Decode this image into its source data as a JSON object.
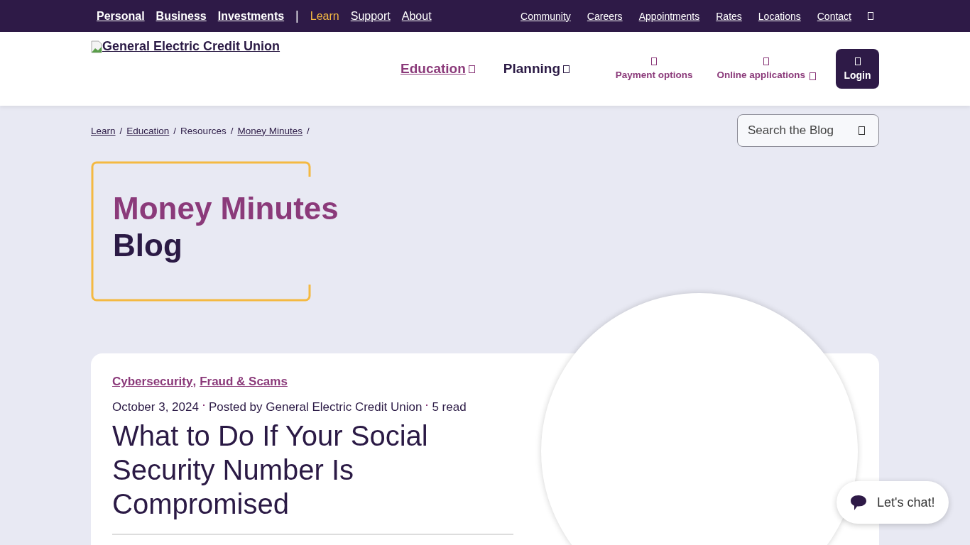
{
  "top_bar": {
    "primary_links": [
      {
        "label": "Personal",
        "selected": false
      },
      {
        "label": "Business",
        "selected": false
      },
      {
        "label": "Investments",
        "selected": false
      }
    ],
    "divider": "|",
    "secondary_links": [
      {
        "label": "Learn",
        "selected": true
      },
      {
        "label": "Support",
        "selected": false
      },
      {
        "label": "About",
        "selected": false
      }
    ],
    "utility_links": [
      "Community",
      "Careers",
      "Appointments",
      "Rates",
      "Locations",
      "Contact"
    ]
  },
  "header": {
    "logo_alt": "General Electric Credit Union",
    "nav": [
      {
        "label": "Education",
        "selected": true
      },
      {
        "label": "Planning",
        "selected": false
      }
    ],
    "actions": [
      {
        "label": "Payment options",
        "has_caret": false
      },
      {
        "label": "Online applications",
        "has_caret": true
      }
    ],
    "login": "Login"
  },
  "breadcrumb": [
    {
      "label": "Learn",
      "link": true,
      "separator": "/"
    },
    {
      "label": "Education",
      "link": true,
      "separator": "/"
    },
    {
      "label": "Resources",
      "link": false,
      "separator": "/"
    },
    {
      "label": "Money Minutes",
      "link": true,
      "separator": "/"
    }
  ],
  "search": {
    "placeholder": "Search the Blog"
  },
  "hero": {
    "title_line_1": "Money Minutes",
    "title_line_2": "Blog"
  },
  "post": {
    "categories": [
      {
        "label": "Cybersecurity",
        "separator": ","
      },
      {
        "label": "Fraud & Scams"
      }
    ],
    "meta": [
      "October 3, 2024",
      "Posted by General Electric Credit Union",
      "5 read"
    ],
    "title": "What to Do If Your Social Security Number Is Compromised"
  },
  "chat": {
    "label": "Let's chat!"
  }
}
